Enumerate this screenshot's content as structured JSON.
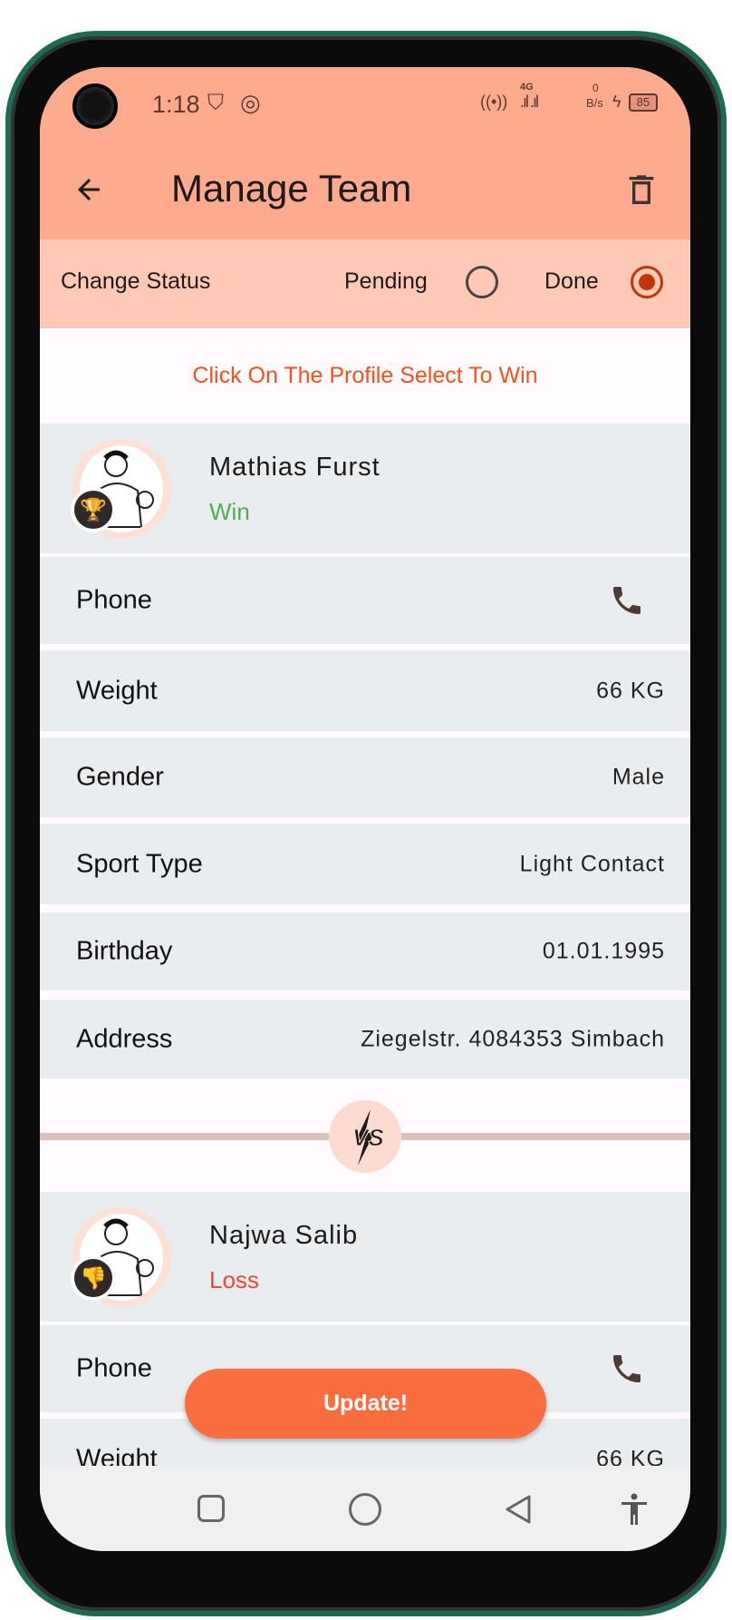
{
  "status_bar": {
    "time": "1:18",
    "network": "4G",
    "speed": "0",
    "speed_unit": "B/s",
    "battery": "85"
  },
  "app_bar": {
    "title": "Manage Team",
    "back_icon": "arrow-left-icon",
    "delete_icon": "trash-icon"
  },
  "status_row": {
    "label": "Change Status",
    "options": [
      {
        "label": "Pending",
        "selected": false
      },
      {
        "label": "Done",
        "selected": true
      }
    ]
  },
  "hint": "Click On The Profile Select To Win",
  "players": [
    {
      "name": "Mathias Furst",
      "result": "Win",
      "result_color": "#4caf50",
      "badge_icon": "trophy-icon",
      "fields": [
        {
          "label": "Phone",
          "value": null,
          "icon": "phone-icon"
        },
        {
          "label": "Weight",
          "value": "66 KG"
        },
        {
          "label": "Gender",
          "value": "Male"
        },
        {
          "label": "Sport Type",
          "value": "Light Contact"
        },
        {
          "label": "Birthday",
          "value": "01.01.1995"
        },
        {
          "label": "Address",
          "value": "Ziegelstr. 4084353 Simbach"
        }
      ]
    },
    {
      "name": "Najwa Salib",
      "result": "Loss",
      "result_color": "#f44336",
      "badge_icon": "thumbs-down-icon",
      "fields": [
        {
          "label": "Phone",
          "value": null,
          "icon": "phone-icon"
        },
        {
          "label": "Weight",
          "value": "66 KG"
        }
      ]
    }
  ],
  "vs_label": "VS",
  "update_button": "Update!",
  "colors": {
    "app_bar": "#feaa8e",
    "status_row": "#ffc9b6",
    "accent": "#f96d3f",
    "hint": "#f4511e"
  }
}
